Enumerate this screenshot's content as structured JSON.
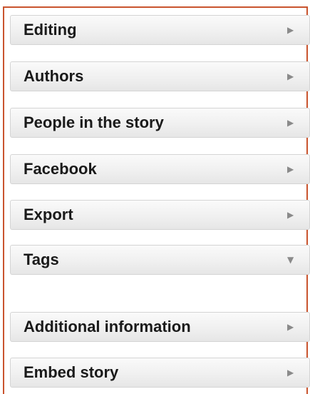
{
  "sections": {
    "editing": {
      "label": "Editing",
      "icon": "chevron-right-icon",
      "glyph": "▶"
    },
    "authors": {
      "label": "Authors",
      "icon": "chevron-right-icon",
      "glyph": "▶"
    },
    "people": {
      "label": "People in the story",
      "icon": "chevron-right-icon",
      "glyph": "▶"
    },
    "facebook": {
      "label": "Facebook",
      "icon": "chevron-right-icon",
      "glyph": "▶"
    },
    "export": {
      "label": "Export",
      "icon": "chevron-right-icon",
      "glyph": "▶"
    },
    "tags": {
      "label": "Tags",
      "icon": "chevron-down-icon",
      "glyph": "▼",
      "expanded": true
    },
    "additional": {
      "label": "Additional information",
      "icon": "chevron-right-icon",
      "glyph": "▶"
    },
    "embed": {
      "label": "Embed story",
      "icon": "chevron-right-icon",
      "glyph": "▶"
    }
  },
  "colors": {
    "frame_border": "#c9542e",
    "panel_text": "#1a1a1a",
    "chevron": "#8a8a8a"
  }
}
